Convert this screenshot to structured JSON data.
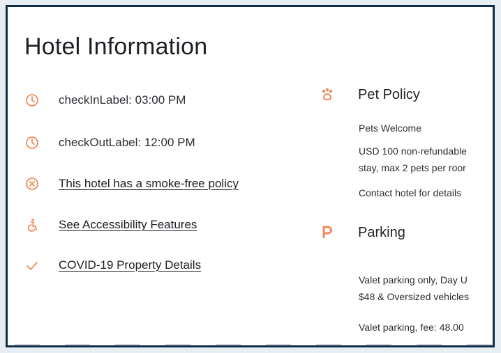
{
  "page": {
    "title": "Hotel Information"
  },
  "left_items": [
    {
      "icon": "clock-icon",
      "text": "checkInLabel: 03:00 PM",
      "link": false
    },
    {
      "icon": "clock-icon",
      "text": "checkOutLabel: 12:00 PM",
      "link": false
    },
    {
      "icon": "no-smoking-icon",
      "text": "This hotel has a smoke-free policy",
      "link": true
    },
    {
      "icon": "accessibility-icon",
      "text": "See Accessibility Features",
      "link": true
    },
    {
      "icon": "check-icon",
      "text": "COVID-19 Property Details",
      "link": true
    }
  ],
  "pet_policy": {
    "heading": "Pet Policy",
    "icon": "paw-icon",
    "lines": [
      "Pets Welcome",
      "USD 100 non-refundable",
      "stay, max 2 pets per roor",
      "Contact hotel for details"
    ]
  },
  "parking": {
    "heading": "Parking",
    "icon": "parking-icon",
    "lines": [
      "Valet parking only, Day U",
      "$48 & Oversized vehicles",
      "Valet parking, fee: 48.00"
    ]
  },
  "colors": {
    "accent": "#f08a5d",
    "border": "#0f2c48",
    "text": "#1c1f24"
  }
}
